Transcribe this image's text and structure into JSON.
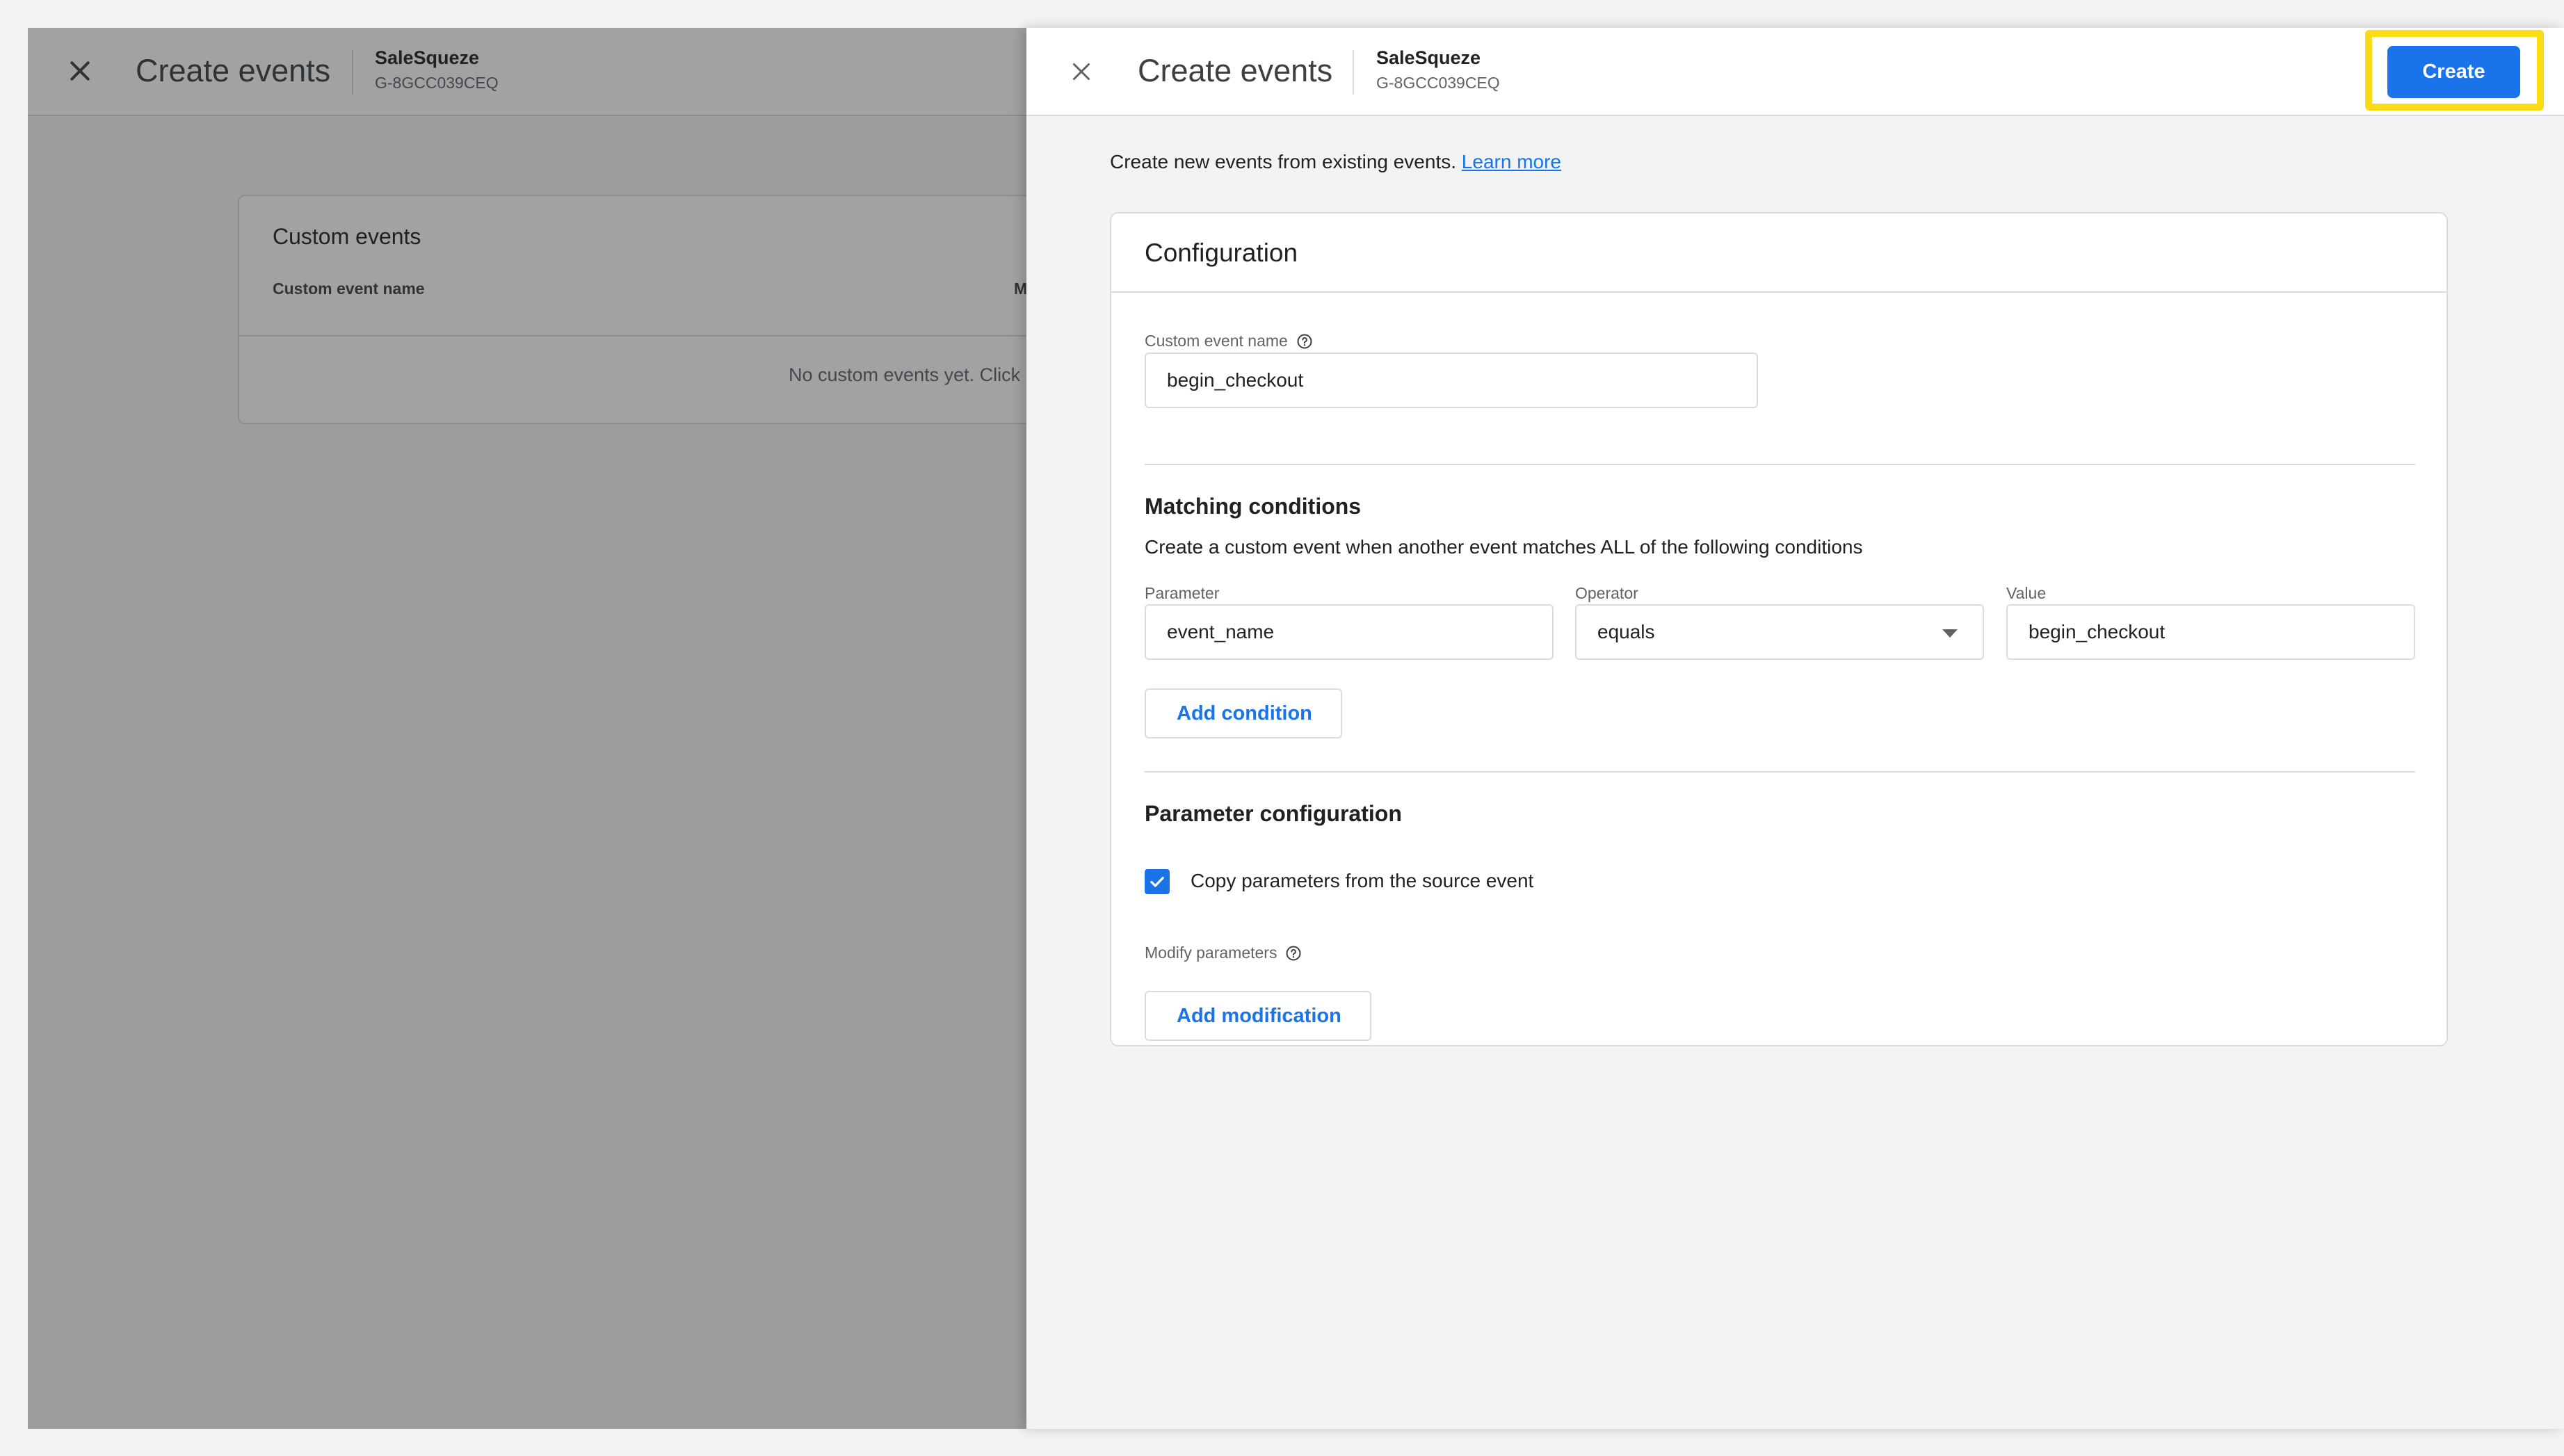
{
  "background": {
    "header": {
      "title": "Create events",
      "property_name": "SaleSqueze",
      "property_id": "G-8GCC039CEQ"
    },
    "custom_events_card": {
      "title": "Custom events",
      "column_name": "Custom event name",
      "column_partial": "M",
      "empty_text": "No custom events yet. Click '"
    }
  },
  "drawer": {
    "header": {
      "title": "Create events",
      "property_name": "SaleSqueze",
      "property_id": "G-8GCC039CEQ",
      "create_label": "Create"
    },
    "intro_text": "Create new events from existing events. ",
    "learn_more_label": "Learn more",
    "configuration": {
      "title": "Configuration",
      "custom_event_name_label": "Custom event name",
      "custom_event_name_value": "begin_checkout",
      "matching": {
        "title": "Matching conditions",
        "description": "Create a custom event when another event matches ALL of the following conditions",
        "parameter_label": "Parameter",
        "parameter_value": "event_name",
        "operator_label": "Operator",
        "operator_value": "equals",
        "value_label": "Value",
        "value_value": "begin_checkout",
        "add_condition_label": "Add condition"
      },
      "parameter_configuration": {
        "title": "Parameter configuration",
        "copy_parameters_label": "Copy parameters from the source event",
        "copy_parameters_checked": true,
        "modify_parameters_label": "Modify parameters",
        "add_modification_label": "Add modification"
      }
    }
  },
  "colors": {
    "accent": "#1a73e8",
    "highlight": "#fbdb14",
    "border": "#dadce0"
  },
  "icons": [
    "close-icon",
    "help-circle-icon",
    "dropdown-arrow-icon",
    "checkmark-icon"
  ]
}
